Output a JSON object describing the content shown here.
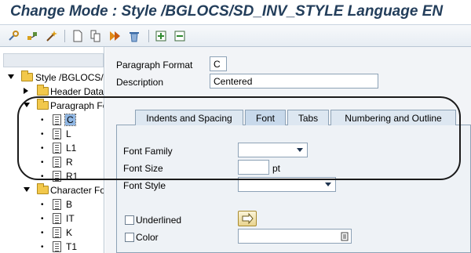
{
  "window": {
    "title": "Change Mode : Style /BGLOCS/SD_INV_STYLE Language EN"
  },
  "toolbar": {
    "icons": [
      "settings-icon",
      "hierarchy-icon",
      "magic-wand-icon",
      "new-document-icon",
      "copy-icon",
      "execute-icon",
      "delete-icon",
      "insert-icon",
      "remove-icon"
    ]
  },
  "tree": {
    "style_node": "Style /BGLOCS/SD_INV_STYLE",
    "header_data": "Header Data",
    "paragraph_formats": "Paragraph Formats",
    "paragraph_items": [
      "C",
      "L",
      "L1",
      "R",
      "R1"
    ],
    "character_formats": "Character Formats",
    "character_items": [
      "B",
      "IT",
      "K",
      "T1"
    ]
  },
  "form": {
    "paragraph_format_label": "Paragraph Format",
    "paragraph_format_value": "C",
    "description_label": "Description",
    "description_value": "Centered"
  },
  "tabs": [
    "Indents and Spacing",
    "Font",
    "Tabs",
    "Numbering and Outline"
  ],
  "active_tab": "Font",
  "font_tab": {
    "font_family_label": "Font Family",
    "font_family_value": "",
    "font_size_label": "Font Size",
    "font_size_value": "",
    "font_size_unit": "pt",
    "font_style_label": "Font Style",
    "font_style_value": "",
    "underlined_label": "Underlined",
    "color_label": "Color"
  },
  "colors": {
    "title_text": "#233e5b",
    "folder": "#f2c84b",
    "selection": "#8fb6e3",
    "active_tab": "#c8d9eb"
  }
}
